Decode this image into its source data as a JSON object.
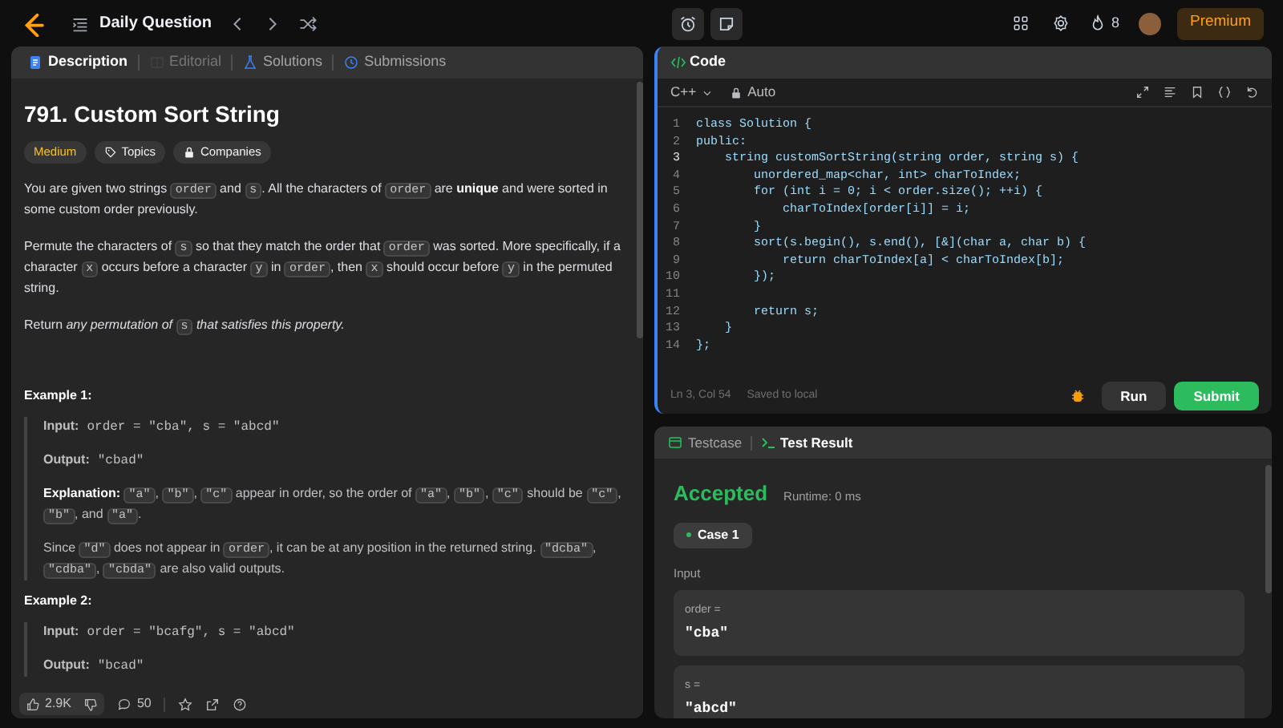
{
  "top_bar": {
    "title": "Daily Question",
    "streak": "8",
    "premium": "Premium"
  },
  "left_panel": {
    "tabs": [
      {
        "label": "Description",
        "selected": true,
        "disabled": false
      },
      {
        "label": "Editorial",
        "selected": false,
        "disabled": true
      },
      {
        "label": "Solutions",
        "selected": false,
        "disabled": false
      },
      {
        "label": "Submissions",
        "selected": false,
        "disabled": false
      }
    ],
    "problem": {
      "title": "791. Custom Sort String",
      "difficulty": "Medium",
      "tags": [
        "Topics",
        "Companies"
      ],
      "paragraphs": [
        [
          {
            "kind": "text",
            "text": "You are given two strings "
          },
          {
            "kind": "code",
            "text": "order"
          },
          {
            "kind": "text",
            "text": " and "
          },
          {
            "kind": "code",
            "text": "s"
          },
          {
            "kind": "text",
            "text": ". All the characters of "
          },
          {
            "kind": "code",
            "text": "order"
          },
          {
            "kind": "text",
            "text": " are "
          },
          {
            "kind": "bold",
            "text": "unique"
          },
          {
            "kind": "text",
            "text": " and were sorted in some custom order previously."
          }
        ],
        [
          {
            "kind": "text",
            "text": "Permute the characters of "
          },
          {
            "kind": "code",
            "text": "s"
          },
          {
            "kind": "text",
            "text": " so that they match the order that "
          },
          {
            "kind": "code",
            "text": "order"
          },
          {
            "kind": "text",
            "text": " was sorted. More specifically, if a character "
          },
          {
            "kind": "code",
            "text": "x"
          },
          {
            "kind": "text",
            "text": " occurs before a character "
          },
          {
            "kind": "code",
            "text": "y"
          },
          {
            "kind": "text",
            "text": " in "
          },
          {
            "kind": "code",
            "text": "order"
          },
          {
            "kind": "text",
            "text": ", then "
          },
          {
            "kind": "code",
            "text": "x"
          },
          {
            "kind": "text",
            "text": " should occur before "
          },
          {
            "kind": "code",
            "text": "y"
          },
          {
            "kind": "text",
            "text": " in the permuted string."
          }
        ],
        [
          {
            "kind": "text",
            "text": "Return "
          },
          {
            "kind": "italic",
            "text": "any permutation of "
          },
          {
            "kind": "code",
            "text": "s"
          },
          {
            "kind": "italic",
            "text": " that satisfies this property."
          }
        ]
      ],
      "examples": [
        {
          "title": "Example 1:",
          "items": [
            {
              "kind": "io",
              "label": "Input:",
              "value": "order = \"cba\", s = \"abcd\""
            },
            {
              "kind": "io",
              "label": "Output:",
              "value": "\"cbad\""
            },
            {
              "kind": "para",
              "segments": [
                {
                  "kind": "bold",
                  "text": "Explanation: "
                },
                {
                  "kind": "code",
                  "text": "\"a\""
                },
                {
                  "kind": "text",
                  "text": ", "
                },
                {
                  "kind": "code",
                  "text": "\"b\""
                },
                {
                  "kind": "text",
                  "text": ", "
                },
                {
                  "kind": "code",
                  "text": "\"c\""
                },
                {
                  "kind": "text",
                  "text": " appear in order, so the order of "
                },
                {
                  "kind": "code",
                  "text": "\"a\""
                },
                {
                  "kind": "text",
                  "text": ", "
                },
                {
                  "kind": "code",
                  "text": "\"b\""
                },
                {
                  "kind": "text",
                  "text": ", "
                },
                {
                  "kind": "code",
                  "text": "\"c\""
                },
                {
                  "kind": "text",
                  "text": " should be "
                },
                {
                  "kind": "code",
                  "text": "\"c\""
                },
                {
                  "kind": "text",
                  "text": ", "
                },
                {
                  "kind": "code",
                  "text": "\"b\""
                },
                {
                  "kind": "text",
                  "text": ", and "
                },
                {
                  "kind": "code",
                  "text": "\"a\""
                },
                {
                  "kind": "text",
                  "text": "."
                }
              ]
            },
            {
              "kind": "para",
              "segments": [
                {
                  "kind": "text",
                  "text": "Since "
                },
                {
                  "kind": "code",
                  "text": "\"d\""
                },
                {
                  "kind": "text",
                  "text": " does not appear in "
                },
                {
                  "kind": "code",
                  "text": "order"
                },
                {
                  "kind": "text",
                  "text": ", it can be at any position in the returned string. "
                },
                {
                  "kind": "code",
                  "text": "\"dcba\""
                },
                {
                  "kind": "text",
                  "text": ", "
                },
                {
                  "kind": "code",
                  "text": "\"cdba\""
                },
                {
                  "kind": "text",
                  "text": ", "
                },
                {
                  "kind": "code",
                  "text": "\"cbda\""
                },
                {
                  "kind": "text",
                  "text": " are also valid outputs."
                }
              ]
            }
          ]
        },
        {
          "title": "Example 2:",
          "items": [
            {
              "kind": "io",
              "label": "Input:",
              "value": "order = \"bcafg\", s = \"abcd\""
            },
            {
              "kind": "io",
              "label": "Output:",
              "value": "\"bcad\""
            }
          ]
        }
      ]
    },
    "footer": {
      "likes": "2.9K",
      "comments": "50"
    }
  },
  "code_panel": {
    "title": "Code",
    "language": "C++",
    "mode": "Auto",
    "lines": [
      {
        "n": "1",
        "text": "class Solution {",
        "current": false
      },
      {
        "n": "2",
        "text": "public:",
        "current": false
      },
      {
        "n": "3",
        "text": "    string customSortString(string order, string s) {",
        "current": true
      },
      {
        "n": "4",
        "text": "        unordered_map<char, int> charToIndex;",
        "current": false
      },
      {
        "n": "5",
        "text": "        for (int i = 0; i < order.size(); ++i) {",
        "current": false
      },
      {
        "n": "6",
        "text": "            charToIndex[order[i]] = i;",
        "current": false
      },
      {
        "n": "7",
        "text": "        }",
        "current": false
      },
      {
        "n": "8",
        "text": "        sort(s.begin(), s.end(), [&](char a, char b) {",
        "current": false
      },
      {
        "n": "9",
        "text": "            return charToIndex[a] < charToIndex[b];",
        "current": false
      },
      {
        "n": "10",
        "text": "        });",
        "current": false
      },
      {
        "n": "11",
        "current": false
      },
      {
        "n": "12",
        "text": "        return s;",
        "current": false
      },
      {
        "n": "13",
        "text": "    }",
        "current": false
      },
      {
        "n": "14",
        "text": "};",
        "current": false
      }
    ],
    "cursor": "Ln 3, Col 54",
    "save_state": "Saved to local",
    "run": "Run",
    "submit": "Submit"
  },
  "test_panel": {
    "tabs": [
      {
        "label": "Testcase",
        "selected": false
      },
      {
        "label": "Test Result",
        "selected": true
      }
    ],
    "verdict": "Accepted",
    "runtime": "Runtime: 0 ms",
    "cases": [
      {
        "label": "Case 1",
        "selected": true
      }
    ],
    "input_label": "Input",
    "params": [
      {
        "name": "order =",
        "value": "\"cba\""
      },
      {
        "name": "s =",
        "value": "\"abcd\""
      }
    ]
  }
}
